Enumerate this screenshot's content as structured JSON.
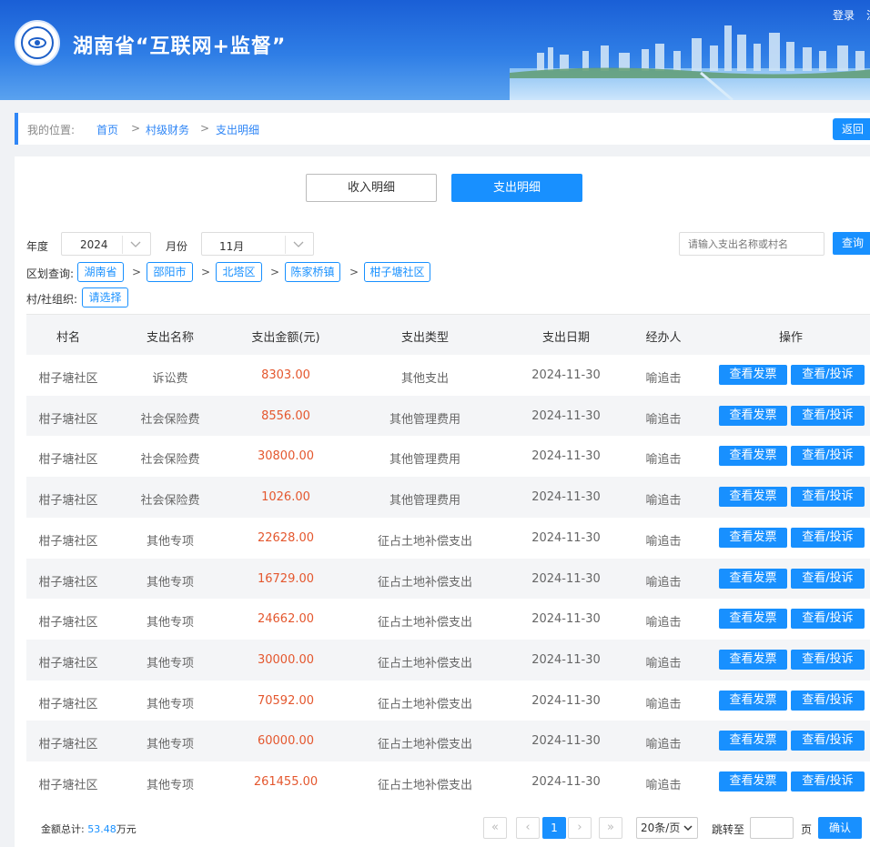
{
  "header": {
    "title": "湖南省“互联网+监督”",
    "login": "登录",
    "login_partial": "注"
  },
  "breadcrumb": {
    "label": "我的位置:",
    "items": [
      "首页",
      "村级财务",
      "支出明细"
    ],
    "sep": ">",
    "back": "返回"
  },
  "tabs": [
    "收入明细",
    "支出明细"
  ],
  "filters": {
    "year_label": "年度",
    "year": "2024",
    "month_label": "月份",
    "month": "11月",
    "search_placeholder": "请输入支出名称或村名",
    "search_button": "查询",
    "region_label": "区划查询:",
    "regions": [
      "湖南省",
      "邵阳市",
      "北塔区",
      "陈家桥镇",
      "柑子塘社区"
    ],
    "region_sep": ">",
    "org_label": "村/社组织:",
    "org_select": "请选择"
  },
  "table": {
    "columns": [
      "村名",
      "支出名称",
      "支出金额(元)",
      "支出类型",
      "支出日期",
      "经办人",
      "操作"
    ],
    "rows": [
      {
        "village": "柑子塘社区",
        "name": "诉讼费",
        "amount": "8303.00",
        "type": "其他支出",
        "date": "2024-11-30",
        "handler": "喻追击"
      },
      {
        "village": "柑子塘社区",
        "name": "社会保险费",
        "amount": "8556.00",
        "type": "其他管理费用",
        "date": "2024-11-30",
        "handler": "喻追击"
      },
      {
        "village": "柑子塘社区",
        "name": "社会保险费",
        "amount": "30800.00",
        "type": "其他管理费用",
        "date": "2024-11-30",
        "handler": "喻追击"
      },
      {
        "village": "柑子塘社区",
        "name": "社会保险费",
        "amount": "1026.00",
        "type": "其他管理费用",
        "date": "2024-11-30",
        "handler": "喻追击"
      },
      {
        "village": "柑子塘社区",
        "name": "其他专项",
        "amount": "22628.00",
        "type": "征占土地补偿支出",
        "date": "2024-11-30",
        "handler": "喻追击"
      },
      {
        "village": "柑子塘社区",
        "name": "其他专项",
        "amount": "16729.00",
        "type": "征占土地补偿支出",
        "date": "2024-11-30",
        "handler": "喻追击"
      },
      {
        "village": "柑子塘社区",
        "name": "其他专项",
        "amount": "24662.00",
        "type": "征占土地补偿支出",
        "date": "2024-11-30",
        "handler": "喻追击"
      },
      {
        "village": "柑子塘社区",
        "name": "其他专项",
        "amount": "30000.00",
        "type": "征占土地补偿支出",
        "date": "2024-11-30",
        "handler": "喻追击"
      },
      {
        "village": "柑子塘社区",
        "name": "其他专项",
        "amount": "70592.00",
        "type": "征占土地补偿支出",
        "date": "2024-11-30",
        "handler": "喻追击"
      },
      {
        "village": "柑子塘社区",
        "name": "其他专项",
        "amount": "60000.00",
        "type": "征占土地补偿支出",
        "date": "2024-11-30",
        "handler": "喻追击"
      },
      {
        "village": "柑子塘社区",
        "name": "其他专项",
        "amount": "261455.00",
        "type": "征占土地补偿支出",
        "date": "2024-11-30",
        "handler": "喻追击"
      }
    ],
    "action_invoice": "查看发票",
    "action_complain": "查看/投诉"
  },
  "footer": {
    "total_label": "金额总计:",
    "total_value": "53.48",
    "total_unit": "万元",
    "current_page": "1",
    "page_size": "20条/页",
    "jump_label": "跳转至",
    "page_label": "页",
    "confirm": "确认"
  },
  "colors": {
    "primary": "#1890ff",
    "amount": "#e4572e",
    "header_top": "#1a5fd6"
  }
}
